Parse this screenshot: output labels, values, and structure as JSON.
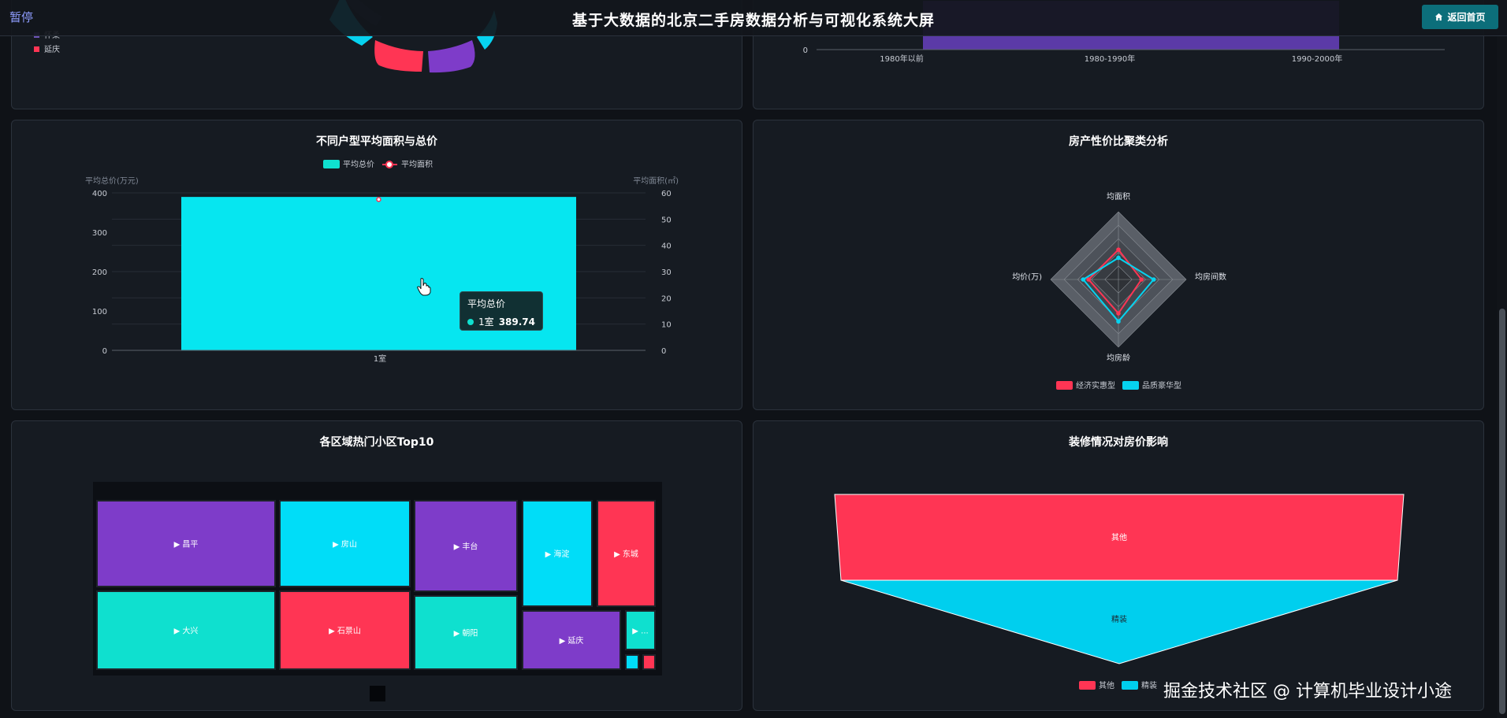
{
  "header": {
    "pause_label": "暂停",
    "title": "基于大数据的北京二手房数据分析与可视化系统大屏",
    "home_button": "返回首页",
    "home_icon": "home-icon"
  },
  "colors": {
    "cyan": "#06e6f0",
    "teal": "#0fe0cf",
    "red": "#ff3554",
    "purple": "#7e3cc9",
    "panel_bg": "#161b22"
  },
  "top_left_panel": {
    "legend_items": [
      "怀柔",
      "延庆"
    ],
    "chart_data": {
      "type": "pie",
      "categories": [
        "延庆"
      ],
      "values": [],
      "title": ""
    }
  },
  "top_right_panel": {
    "chart_data": {
      "type": "bar",
      "categories": [
        "1980年以前",
        "1980-1990年",
        "1990-2000年"
      ],
      "y_tick_visible": "0",
      "title": ""
    }
  },
  "layout_chart": {
    "title": "不同户型平均面积与总价",
    "chart_data": {
      "type": "bar",
      "title": "不同户型平均面积与总价",
      "categories": [
        "1室"
      ],
      "series": [
        {
          "name": "平均总价",
          "values": [
            389.74
          ],
          "axis": "left",
          "kind": "bar"
        },
        {
          "name": "平均面积",
          "values": [
            57.5
          ],
          "axis": "right",
          "kind": "line"
        }
      ],
      "ylabel": "平均总价(万元)",
      "y2label": "平均面积(㎡)",
      "ylim": [
        0,
        400
      ],
      "y2lim": [
        0,
        60
      ],
      "yticks": [
        "0",
        "100",
        "200",
        "300",
        "400"
      ],
      "y2ticks": [
        "0",
        "10",
        "20",
        "30",
        "40",
        "50",
        "60"
      ]
    },
    "tooltip": {
      "title": "平均总价",
      "category": "1室",
      "value": "389.74"
    }
  },
  "radar_chart": {
    "title": "房产性价比聚类分析",
    "chart_data": {
      "type": "radar",
      "title": "房产性价比聚类分析",
      "indicators": [
        "均面积",
        "均房间数",
        "均房龄",
        "均价(万)"
      ],
      "series": [
        {
          "name": "经济实惠型",
          "values": [
            0.44,
            0.34,
            0.5,
            0.44
          ],
          "color": "#ff3554"
        },
        {
          "name": "品质豪华型",
          "values": [
            0.32,
            0.52,
            0.62,
            0.52
          ],
          "color": "#06d3f0"
        }
      ]
    }
  },
  "treemap_chart": {
    "title": "各区域热门小区Top10",
    "chart_data": {
      "type": "treemap",
      "title": "各区域热门小区Top10",
      "items": [
        {
          "label": "▶ 昌平",
          "color": "#7e3cc9"
        },
        {
          "label": "▶ 房山",
          "color": "#00ddf8"
        },
        {
          "label": "▶ 丰台",
          "color": "#7e3cc9"
        },
        {
          "label": "▶ 海淀",
          "color": "#00ddf8"
        },
        {
          "label": "▶ 东城",
          "color": "#ff3554"
        },
        {
          "label": "▶ 大兴",
          "color": "#0fe0cf"
        },
        {
          "label": "▶ 石景山",
          "color": "#ff3554"
        },
        {
          "label": "▶ 朝阳",
          "color": "#0fe0cf"
        },
        {
          "label": "▶ 延庆",
          "color": "#7e3cc9"
        },
        {
          "label": "▶ ...",
          "color": "#0fe0cf"
        },
        {
          "label": "",
          "color": "#00ddf8"
        },
        {
          "label": "",
          "color": "#ff3554"
        }
      ]
    }
  },
  "funnel_chart": {
    "title": "装修情况对房价影响",
    "chart_data": {
      "type": "funnel",
      "title": "装修情况对房价影响",
      "categories": [
        "其他",
        "精装"
      ],
      "legend": [
        "其他",
        "精装"
      ],
      "colors": [
        "#ff3554",
        "#00cfee"
      ]
    }
  },
  "watermark": "掘金技术社区 @ 计算机毕业设计小途"
}
